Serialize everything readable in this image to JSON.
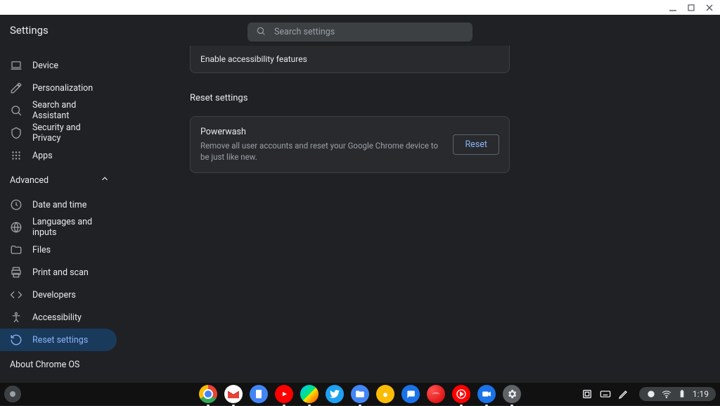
{
  "window": {
    "app_title": "Settings"
  },
  "search": {
    "placeholder": "Search settings"
  },
  "sidebar": {
    "items": [
      {
        "label": "Device"
      },
      {
        "label": "Personalization"
      },
      {
        "label": "Search and Assistant"
      },
      {
        "label": "Security and Privacy"
      },
      {
        "label": "Apps"
      }
    ],
    "advanced_label": "Advanced",
    "advanced_items": [
      {
        "label": "Date and time"
      },
      {
        "label": "Languages and inputs"
      },
      {
        "label": "Files"
      },
      {
        "label": "Print and scan"
      },
      {
        "label": "Developers"
      },
      {
        "label": "Accessibility"
      },
      {
        "label": "Reset settings"
      }
    ],
    "about_label": "About Chrome OS"
  },
  "content": {
    "accessibility_row": "Enable accessibility features",
    "section_title": "Reset settings",
    "powerwash": {
      "title": "Powerwash",
      "desc": "Remove all user accounts and reset your Google Chrome device to be just like new.",
      "button": "Reset"
    }
  },
  "tray": {
    "time": "1:19"
  },
  "shelf_apps": [
    {
      "name": "chrome",
      "running": true,
      "colors": [
        "#ea4335",
        "#4285f4",
        "#34a853",
        "#fbbc04",
        "#fff"
      ]
    },
    {
      "name": "gmail",
      "running": true,
      "bg": "#fff"
    },
    {
      "name": "docs",
      "running": false,
      "bg": "#4285f4"
    },
    {
      "name": "youtube",
      "running": true,
      "bg": "#ff0000"
    },
    {
      "name": "play-store",
      "running": true
    },
    {
      "name": "twitter",
      "running": false,
      "bg": "#1da1f2"
    },
    {
      "name": "files",
      "running": true,
      "bg": "#4285f4"
    },
    {
      "name": "camera",
      "running": false,
      "bg": "#fbbc04"
    },
    {
      "name": "messages",
      "running": false,
      "bg": "#1a73e8"
    },
    {
      "name": "stadia",
      "running": false,
      "bg": "#ea4335"
    },
    {
      "name": "youtube-music",
      "running": true,
      "bg": "#ff0000"
    },
    {
      "name": "duo",
      "running": true,
      "bg": "#1a73e8"
    },
    {
      "name": "settings",
      "running": true,
      "bg": "#5f6368"
    }
  ]
}
